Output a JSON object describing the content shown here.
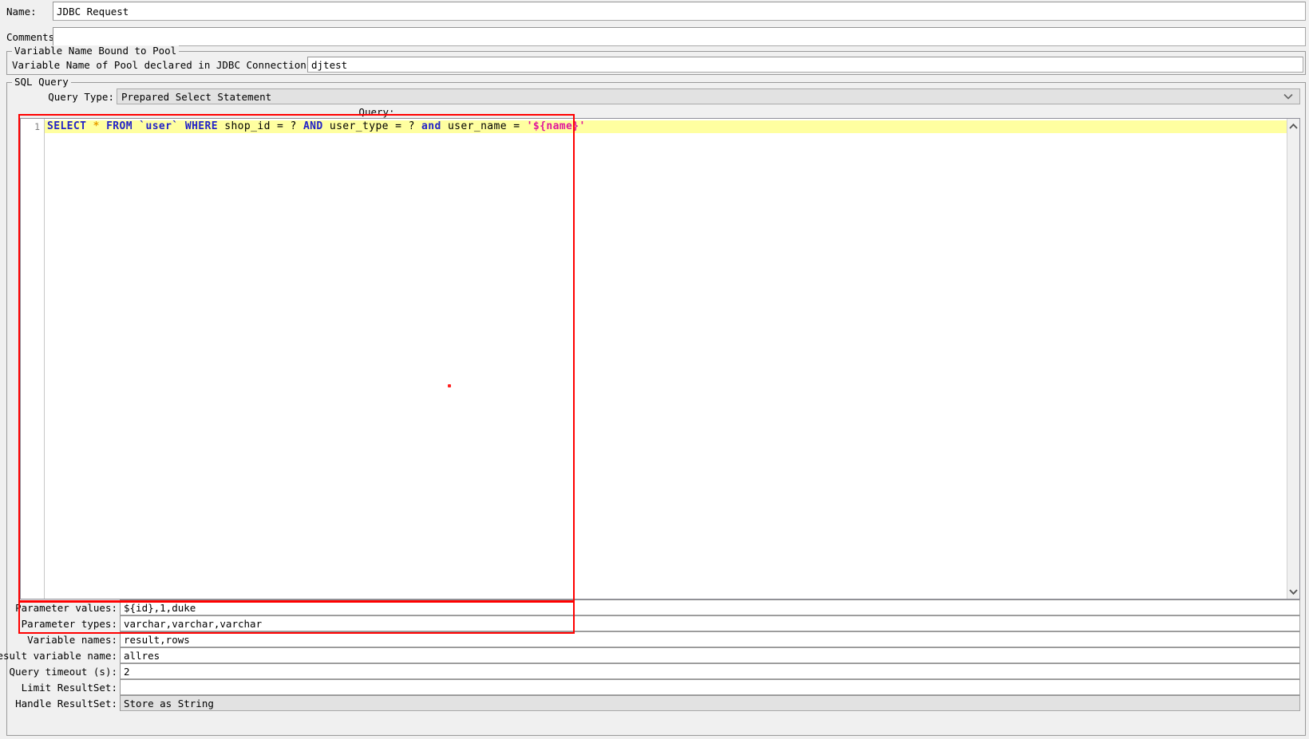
{
  "form": {
    "name_label": "Name:",
    "name_value": "JDBC Request",
    "comments_label": "Comments:",
    "comments_value": ""
  },
  "pool_group": {
    "title": "Variable Name Bound to Pool",
    "pool_label": "Variable Name of Pool declared in JDBC Connection Configuration:",
    "pool_value": "djtest"
  },
  "sql_group": {
    "title": "SQL Query",
    "query_type_label": "Query Type:",
    "query_type_value": "Prepared Select Statement",
    "query_caption": "Query:",
    "line_number": "1",
    "sql_tokens": [
      {
        "text": "SELECT",
        "cls": "kw"
      },
      {
        "text": " ",
        "cls": "plain"
      },
      {
        "text": "*",
        "cls": "star"
      },
      {
        "text": " ",
        "cls": "plain"
      },
      {
        "text": "FROM",
        "cls": "kw"
      },
      {
        "text": " ",
        "cls": "plain"
      },
      {
        "text": "`user`",
        "cls": "tbl"
      },
      {
        "text": " ",
        "cls": "plain"
      },
      {
        "text": "WHERE",
        "cls": "kw"
      },
      {
        "text": " shop_id = ? ",
        "cls": "plain"
      },
      {
        "text": "AND",
        "cls": "kw"
      },
      {
        "text": " user_type = ? ",
        "cls": "plain"
      },
      {
        "text": "and",
        "cls": "kw"
      },
      {
        "text": " user_name = ",
        "cls": "plain"
      },
      {
        "text": "'${name}'",
        "cls": "var"
      }
    ],
    "sql_text": "SELECT * FROM `user` WHERE shop_id = ? AND user_type = ? and user_name = '${name}'"
  },
  "fields": [
    {
      "label": "Parameter values:",
      "value": "${id},1,duke",
      "disabled": false
    },
    {
      "label": "Parameter types:",
      "value": "varchar,varchar,varchar",
      "disabled": false
    },
    {
      "label": "Variable names:",
      "value": "result,rows",
      "disabled": false
    },
    {
      "label": "Result variable name:",
      "value": "allres",
      "disabled": false
    },
    {
      "label": "Query timeout (s):",
      "value": "2",
      "disabled": false
    },
    {
      "label": "Limit ResultSet:",
      "value": "",
      "disabled": false
    },
    {
      "label": "Handle ResultSet:",
      "value": "Store as String",
      "disabled": true
    }
  ],
  "icons": {
    "combo_chevron": "chevron-down-icon",
    "scroll_up": "scroll-up-arrow-icon",
    "scroll_down": "scroll-down-arrow-icon"
  },
  "colors": {
    "annotation": "#ff0000",
    "code_highlight": "#ffffa0",
    "keyword": "#2323c8",
    "variable": "#e0189c",
    "star": "#e8a000"
  }
}
